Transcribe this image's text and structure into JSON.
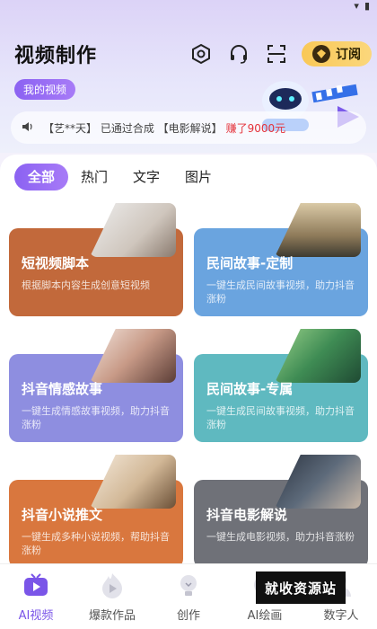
{
  "header": {
    "title": "视频制作",
    "my_video": "我的视频",
    "subscribe": "订阅",
    "icons": [
      "settings-hex-icon",
      "headset-icon",
      "scan-icon"
    ]
  },
  "notice": {
    "icon": "speaker-icon",
    "text": "【艺**天】 已通过合成 【电影解说】",
    "highlight": "赚了9000元"
  },
  "tabs": [
    {
      "label": "全部",
      "active": true
    },
    {
      "label": "热门",
      "active": false
    },
    {
      "label": "文字",
      "active": false
    },
    {
      "label": "图片",
      "active": false
    }
  ],
  "cards": [
    {
      "title": "短视频脚本",
      "desc": "根据脚本内容生成创意短视频",
      "color": "#c2693b"
    },
    {
      "title": "民间故事-定制",
      "desc": "一键生成民间故事视频，助力抖音涨粉",
      "color": "#6aa4df"
    },
    {
      "title": "抖音情感故事",
      "desc": "一键生成情感故事视频，助力抖音涨粉",
      "color": "#8e8ee0"
    },
    {
      "title": "民间故事-专属",
      "desc": "一键生成民间故事视频，助力抖音涨粉",
      "color": "#5fb9c0"
    },
    {
      "title": "抖音小说推文",
      "desc": "一键生成多种小说视频，帮助抖音涨粉",
      "color": "#d9773e"
    },
    {
      "title": "抖音电影解说",
      "desc": "一键生成电影视频，助力抖音涨粉",
      "color": "#6f7178"
    }
  ],
  "bottom_nav": [
    {
      "label": "AI视频",
      "active": true
    },
    {
      "label": "爆款作品",
      "active": false
    },
    {
      "label": "创作",
      "active": false
    },
    {
      "label": "AI绘画",
      "active": false
    },
    {
      "label": "数字人",
      "active": false
    }
  ],
  "watermark": "就收资源站"
}
